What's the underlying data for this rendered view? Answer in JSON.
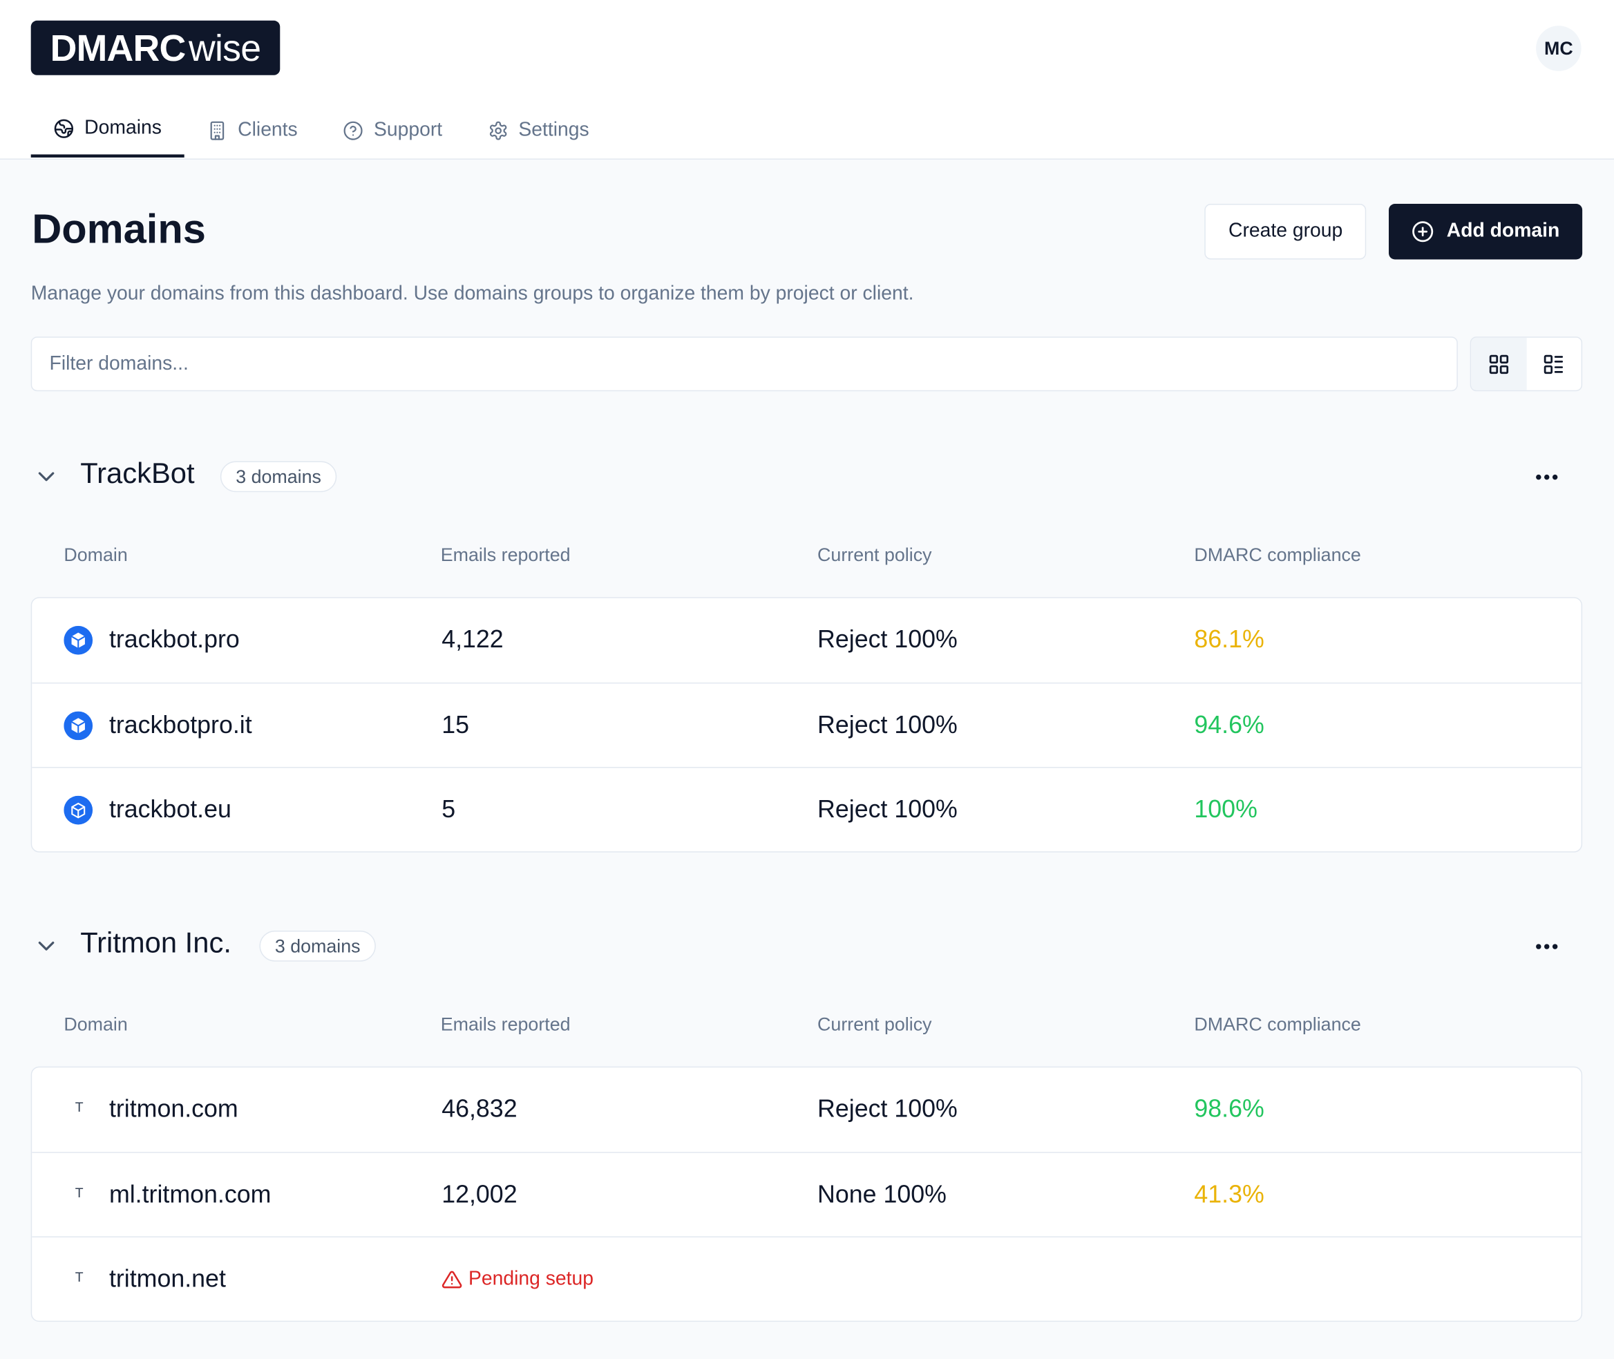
{
  "app": {
    "logo_bold": "DMARC",
    "logo_light": "wise",
    "avatar_initials": "MC"
  },
  "nav": [
    {
      "label": "Domains",
      "icon": "globe-icon",
      "active": true
    },
    {
      "label": "Clients",
      "icon": "building-icon",
      "active": false
    },
    {
      "label": "Support",
      "icon": "help-circle-icon",
      "active": false
    },
    {
      "label": "Settings",
      "icon": "gear-icon",
      "active": false
    }
  ],
  "page": {
    "title": "Domains",
    "subtitle": "Manage your domains from this dashboard. Use domains groups to organize them by project or client.",
    "create_group_label": "Create group",
    "add_domain_label": "Add domain",
    "filter_placeholder": "Filter domains..."
  },
  "columns": [
    "Domain",
    "Emails reported",
    "Current policy",
    "DMARC compliance"
  ],
  "colors": {
    "warning": "#eab308",
    "success": "#22c55e",
    "danger": "#dc2626",
    "brand_blue": "#1d6cf0"
  },
  "groups": [
    {
      "name": "TrackBot",
      "count_label": "3 domains",
      "rows": [
        {
          "domain": "trackbot.pro",
          "emails": "4,122",
          "policy": "Reject 100%",
          "compliance": "86.1%",
          "status": "warning"
        },
        {
          "domain": "trackbotpro.it",
          "emails": "15",
          "policy": "Reject 100%",
          "compliance": "94.6%",
          "status": "success"
        },
        {
          "domain": "trackbot.eu",
          "emails": "5",
          "policy": "Reject 100%",
          "compliance": "100%",
          "status": "success"
        }
      ]
    },
    {
      "name": "Tritmon Inc.",
      "count_label": "3 domains",
      "rows": [
        {
          "domain": "tritmon.com",
          "letter": "T",
          "emails": "46,832",
          "policy": "Reject 100%",
          "compliance": "98.6%",
          "status": "success"
        },
        {
          "domain": "ml.tritmon.com",
          "letter": "T",
          "emails": "12,002",
          "policy": "None 100%",
          "compliance": "41.3%",
          "status": "warning"
        },
        {
          "domain": "tritmon.net",
          "letter": "T",
          "pending_label": "Pending setup"
        }
      ]
    }
  ]
}
